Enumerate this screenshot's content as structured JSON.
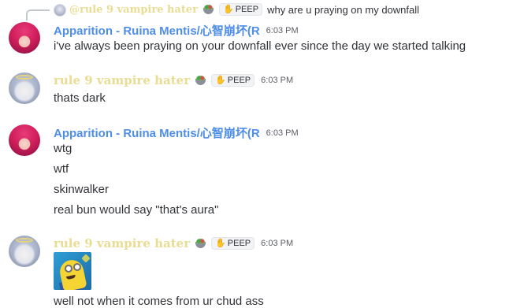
{
  "reply": {
    "username": "@rule 9 vampire hater",
    "tag": "PEEP",
    "text": "why are u praying on my downfall"
  },
  "messages": [
    {
      "username": "Apparition - Ruina Mentis/心智崩坏(R",
      "time": "6:03 PM",
      "lines": [
        "i've always been praying on your downfall ever since the day we started talking"
      ]
    },
    {
      "username": "rule 9 vampire hater",
      "tag": "PEEP",
      "time": "6:03 PM",
      "lines": [
        "thats dark"
      ]
    },
    {
      "username": "Apparition - Ruina Mentis/心智崩坏(R",
      "time": "6:03 PM",
      "lines": [
        "wtg",
        "wtf",
        "skinwalker",
        "real bun would say \"that's aura\""
      ]
    },
    {
      "username": "rule 9 vampire hater",
      "tag": "PEEP",
      "time": "6:03 PM",
      "lines": [
        "well not when it comes from ur chud ass"
      ]
    }
  ],
  "colors": {
    "blue_name": "#4e8ee8",
    "gold_name": "#e9dc93",
    "text": "#313338",
    "timestamp": "#5c5e66"
  },
  "icons": {
    "reply_spine": "reply-spine",
    "clan_badge": "potted-plant-icon",
    "tag_icon": "hands-icon"
  }
}
